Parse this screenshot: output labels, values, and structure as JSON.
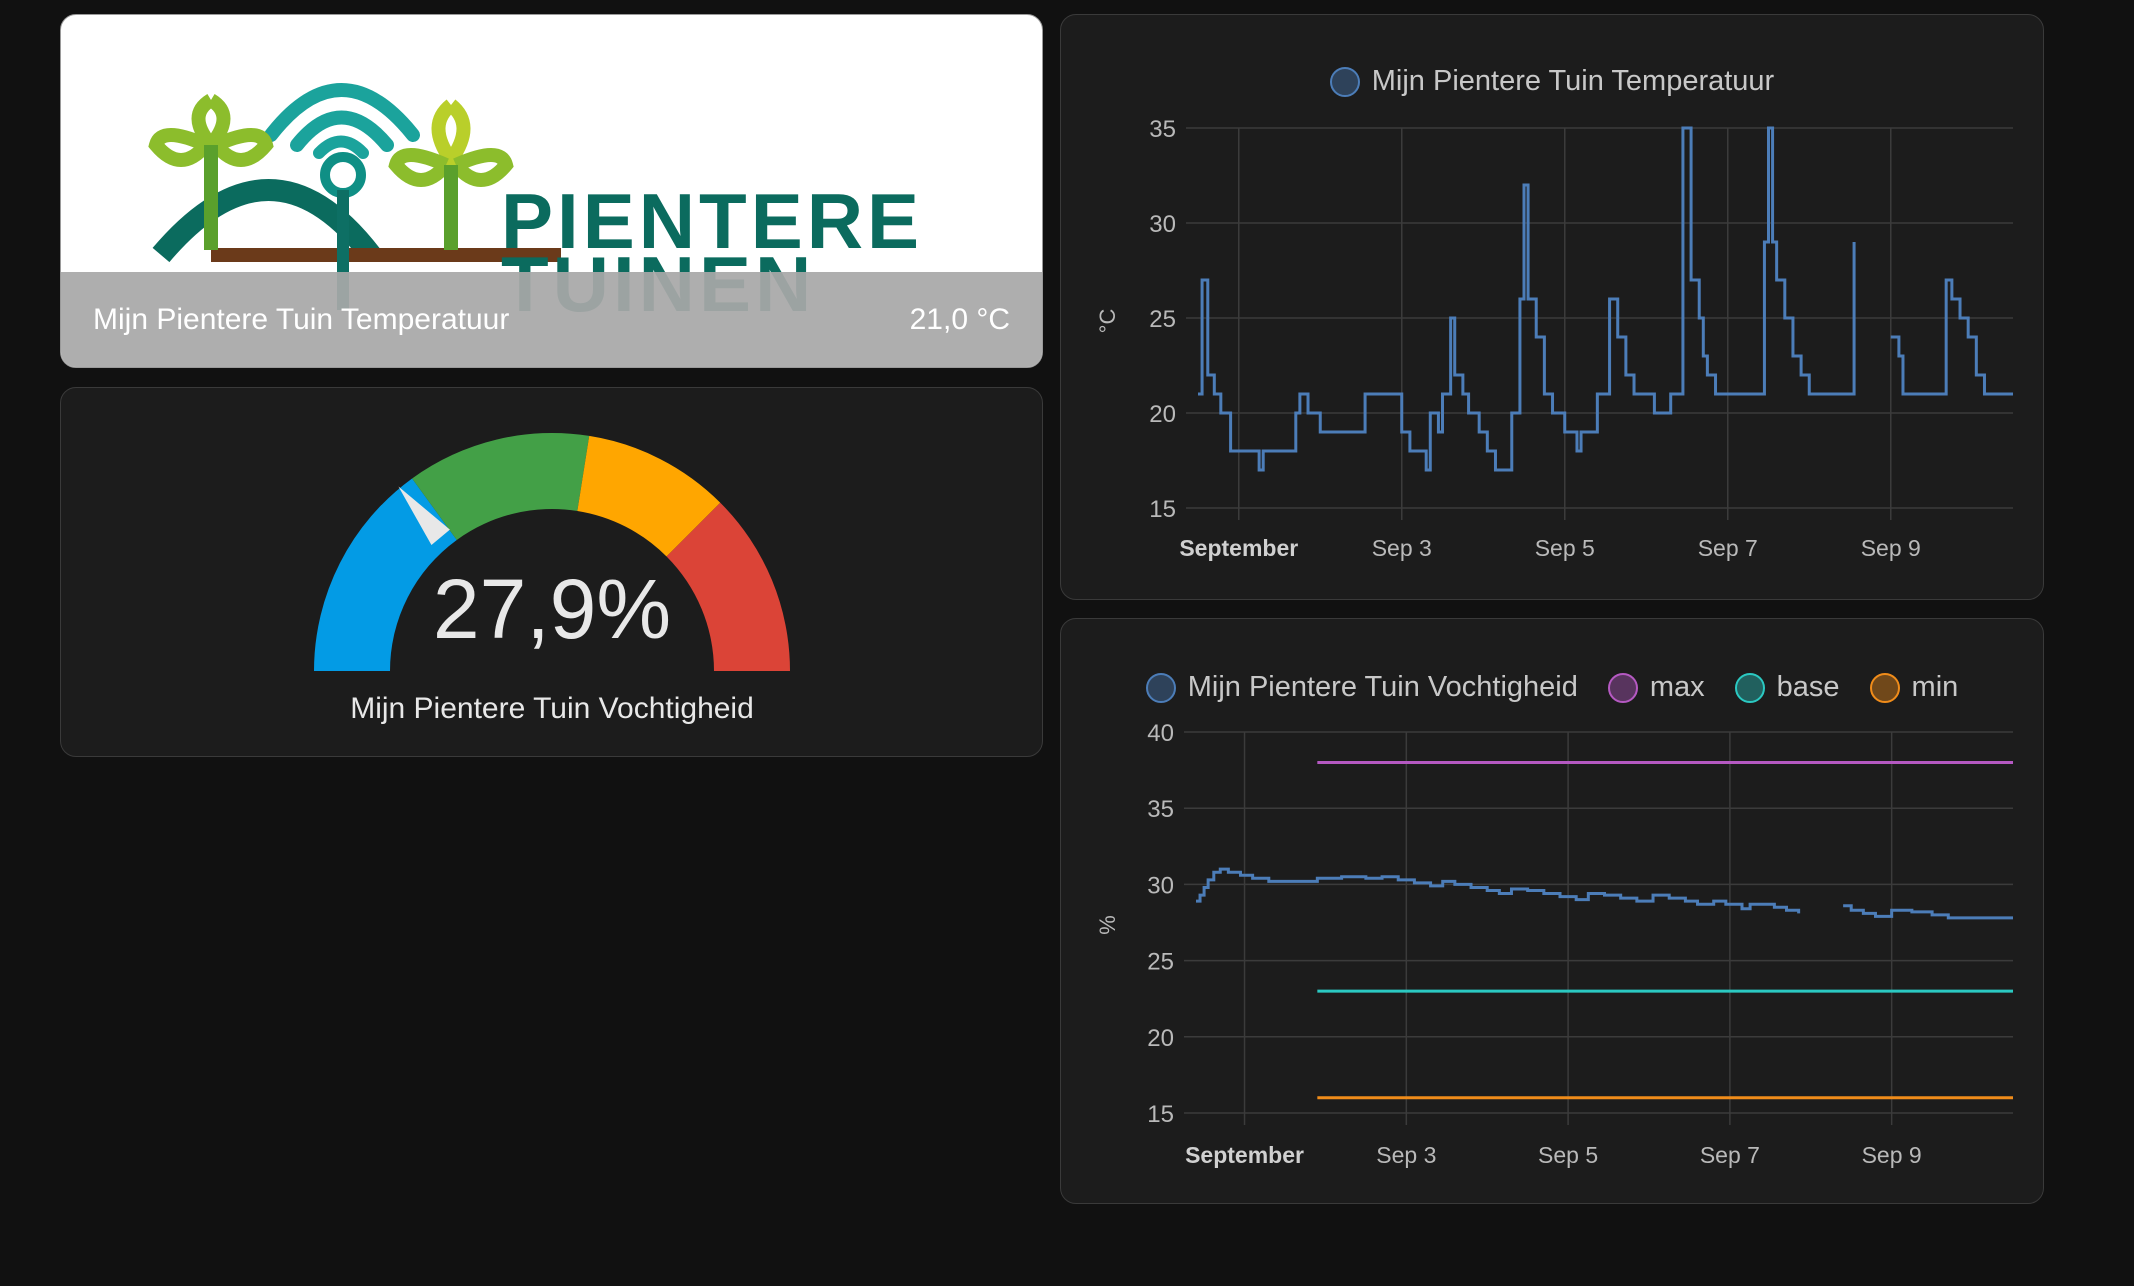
{
  "picture_card": {
    "logo_text_line1": "PIENTERE",
    "logo_text_line2": "TUINEN",
    "name": "Mijn Pientere Tuin Temperatuur",
    "state": "21,0 °C"
  },
  "gauge_card": {
    "value": 27.9,
    "value_text": "27,9%",
    "name": "Mijn Pientere Tuin Vochtigheid",
    "min": 0,
    "max": 100,
    "segments": [
      {
        "from": 0,
        "to": 30,
        "color": "#039be5"
      },
      {
        "from": 30,
        "to": 55,
        "color": "#43a047"
      },
      {
        "from": 55,
        "to": 75,
        "color": "#ffa600"
      },
      {
        "from": 75,
        "to": 100,
        "color": "#db4437"
      }
    ]
  },
  "chart_data": [
    {
      "type": "line",
      "legend": [
        {
          "name": "Mijn Pientere Tuin Temperatuur",
          "color": "#4c7db8"
        }
      ],
      "ylabel": "°C",
      "xlabel": "",
      "ylim": [
        15,
        35
      ],
      "yticks": [
        "35",
        "30",
        "25",
        "20",
        "15"
      ],
      "xticks": [
        "September",
        "Sep 3",
        "Sep 5",
        "Sep 7",
        "Sep 9"
      ],
      "xlim": [
        0.5,
        10.5
      ],
      "series": [
        {
          "name": "Mijn Pientere Tuin Temperatuur",
          "color": "#4c7db8",
          "step": true,
          "segments": [
            [
              [
                0.5,
                21
              ],
              [
                0.55,
                27
              ],
              [
                0.62,
                22
              ],
              [
                0.7,
                21
              ],
              [
                0.78,
                20
              ],
              [
                0.9,
                18
              ],
              [
                1.1,
                18
              ],
              [
                1.25,
                17
              ],
              [
                1.3,
                18
              ],
              [
                1.6,
                18
              ],
              [
                1.7,
                20
              ],
              [
                1.75,
                21
              ],
              [
                1.85,
                20
              ],
              [
                2.0,
                19
              ],
              [
                2.1,
                19
              ],
              [
                2.55,
                21
              ],
              [
                3.0,
                19
              ],
              [
                3.1,
                18
              ],
              [
                3.3,
                17
              ],
              [
                3.35,
                20
              ],
              [
                3.45,
                19
              ],
              [
                3.5,
                21
              ],
              [
                3.6,
                25
              ],
              [
                3.65,
                22
              ],
              [
                3.75,
                21
              ],
              [
                3.82,
                20
              ],
              [
                3.95,
                19
              ],
              [
                4.05,
                18
              ],
              [
                4.15,
                17
              ],
              [
                4.35,
                20
              ],
              [
                4.45,
                26
              ],
              [
                4.5,
                32
              ],
              [
                4.55,
                26
              ],
              [
                4.65,
                24
              ],
              [
                4.75,
                21
              ],
              [
                4.85,
                20
              ],
              [
                5.0,
                19
              ],
              [
                5.15,
                18
              ],
              [
                5.2,
                19
              ],
              [
                5.3,
                19
              ],
              [
                5.4,
                21
              ],
              [
                5.55,
                26
              ],
              [
                5.65,
                24
              ],
              [
                5.75,
                22
              ],
              [
                5.85,
                21
              ],
              [
                6.0,
                21
              ],
              [
                6.1,
                20
              ],
              [
                6.2,
                20
              ],
              [
                6.3,
                21
              ],
              [
                6.45,
                35
              ],
              [
                6.55,
                27
              ],
              [
                6.65,
                25
              ],
              [
                6.7,
                23
              ],
              [
                6.75,
                22
              ],
              [
                6.85,
                21
              ],
              [
                7.0,
                21
              ],
              [
                7.4,
                21
              ],
              [
                7.45,
                29
              ],
              [
                7.5,
                35
              ],
              [
                7.55,
                29
              ],
              [
                7.6,
                27
              ],
              [
                7.7,
                25
              ],
              [
                7.8,
                23
              ],
              [
                7.9,
                22
              ],
              [
                8.0,
                21
              ],
              [
                8.5,
                21
              ],
              [
                8.55,
                29
              ]
            ],
            [
              [
                9.0,
                24
              ],
              [
                9.1,
                23
              ],
              [
                9.15,
                21
              ],
              [
                9.65,
                21
              ],
              [
                9.68,
                27
              ],
              [
                9.75,
                26
              ],
              [
                9.85,
                25
              ],
              [
                9.95,
                24
              ],
              [
                10.05,
                22
              ],
              [
                10.15,
                21
              ],
              [
                10.5,
                21
              ]
            ]
          ]
        }
      ]
    },
    {
      "type": "line",
      "legend": [
        {
          "name": "Mijn Pientere Tuin Vochtigheid",
          "color": "#4c7db8"
        },
        {
          "name": "max",
          "color": "#b559c2"
        },
        {
          "name": "base",
          "color": "#2bc9c2"
        },
        {
          "name": "min",
          "color": "#f08c1a"
        }
      ],
      "ylabel": "%",
      "xlabel": "",
      "ylim": [
        15,
        40
      ],
      "yticks": [
        "40",
        "35",
        "30",
        "25",
        "20",
        "15"
      ],
      "xticks": [
        "September",
        "Sep 3",
        "Sep 5",
        "Sep 7",
        "Sep 9"
      ],
      "xlim": [
        0.4,
        10.5
      ],
      "series": [
        {
          "name": "Mijn Pientere Tuin Vochtigheid",
          "color": "#4c7db8",
          "step": true,
          "segments": [
            [
              [
                0.4,
                28.9
              ],
              [
                0.45,
                29.3
              ],
              [
                0.5,
                29.8
              ],
              [
                0.55,
                30.3
              ],
              [
                0.62,
                30.8
              ],
              [
                0.7,
                31.0
              ],
              [
                0.8,
                30.8
              ],
              [
                0.95,
                30.6
              ],
              [
                1.1,
                30.4
              ],
              [
                1.3,
                30.2
              ],
              [
                1.6,
                30.2
              ],
              [
                1.9,
                30.4
              ],
              [
                2.2,
                30.5
              ],
              [
                2.5,
                30.4
              ],
              [
                2.7,
                30.5
              ],
              [
                2.9,
                30.3
              ],
              [
                3.1,
                30.1
              ],
              [
                3.3,
                29.9
              ],
              [
                3.45,
                30.2
              ],
              [
                3.6,
                30.0
              ],
              [
                3.8,
                29.8
              ],
              [
                4.0,
                29.6
              ],
              [
                4.15,
                29.4
              ],
              [
                4.3,
                29.7
              ],
              [
                4.5,
                29.6
              ],
              [
                4.7,
                29.4
              ],
              [
                4.9,
                29.2
              ],
              [
                5.1,
                29.0
              ],
              [
                5.25,
                29.4
              ],
              [
                5.45,
                29.3
              ],
              [
                5.65,
                29.1
              ],
              [
                5.85,
                28.9
              ],
              [
                6.05,
                29.3
              ],
              [
                6.25,
                29.1
              ],
              [
                6.45,
                28.9
              ],
              [
                6.6,
                28.7
              ],
              [
                6.8,
                28.9
              ],
              [
                6.95,
                28.7
              ],
              [
                7.15,
                28.4
              ],
              [
                7.25,
                28.7
              ],
              [
                7.4,
                28.7
              ],
              [
                7.55,
                28.5
              ],
              [
                7.7,
                28.3
              ],
              [
                7.85,
                28.1
              ]
            ],
            [
              [
                8.4,
                28.6
              ],
              [
                8.5,
                28.3
              ],
              [
                8.65,
                28.1
              ],
              [
                8.8,
                27.9
              ],
              [
                9.0,
                28.3
              ],
              [
                9.25,
                28.2
              ],
              [
                9.5,
                28.0
              ],
              [
                9.7,
                27.8
              ],
              [
                10.5,
                27.8
              ]
            ]
          ]
        },
        {
          "name": "max",
          "color": "#b559c2",
          "step": false,
          "segments": [
            [
              [
                1.9,
                38.0
              ],
              [
                10.5,
                38.0
              ]
            ]
          ]
        },
        {
          "name": "base",
          "color": "#2bc9c2",
          "step": false,
          "segments": [
            [
              [
                1.9,
                23.0
              ],
              [
                10.5,
                23.0
              ]
            ]
          ]
        },
        {
          "name": "min",
          "color": "#f08c1a",
          "step": false,
          "segments": [
            [
              [
                1.9,
                16.0
              ],
              [
                10.5,
                16.0
              ]
            ]
          ]
        }
      ]
    }
  ]
}
